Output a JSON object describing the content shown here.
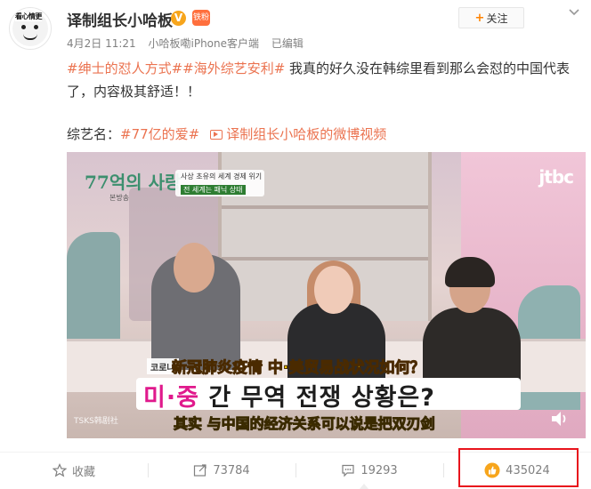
{
  "post": {
    "avatar_tag": "看心情更",
    "username": "译制组长小哈板",
    "vip_badge": "V",
    "fan_badge": "铁粉",
    "date": "4月2日 11:21",
    "source": "小哈板嘞iPhone客户端",
    "edited": "已编辑",
    "follow_label": "关注",
    "follow_plus": "+",
    "topic1": "#绅士的怼人方式#",
    "topic2": "#海外综艺安利#",
    "text": " 我真的好久没在韩综里看到那么会怼的中国代表了，内容极其舒适！！",
    "variety_label": "综艺名：",
    "variety_topic": "#77亿的爱#",
    "video_link": "译制组长小哈板的微博视频"
  },
  "video": {
    "logo": "77억의 사랑",
    "logo_sub": "본방송",
    "caption_line1": "사상 초유의 세계 경제 위기",
    "caption_line2": "전 세계는 패닉 상태",
    "channel": "jtbc",
    "small_sub": "코로나",
    "cn_sub1": "新冠肺炎疫情 中·美贸易战状况如何？",
    "kr_sub_hl": "미·중",
    "kr_sub_rest": " 간 무역 전쟁 상황은?",
    "cn_sub2": "其实 与中国的经济关系可以说是把双刃剑",
    "watermark": "TSKS韩剧社"
  },
  "actions": {
    "favorite": "收藏",
    "repost_count": "73784",
    "comment_count": "19293",
    "like_count": "435024"
  },
  "colors": {
    "link": "#eb7350",
    "highlight_border": "#e8141c",
    "like_icon": "#f7a51c"
  }
}
